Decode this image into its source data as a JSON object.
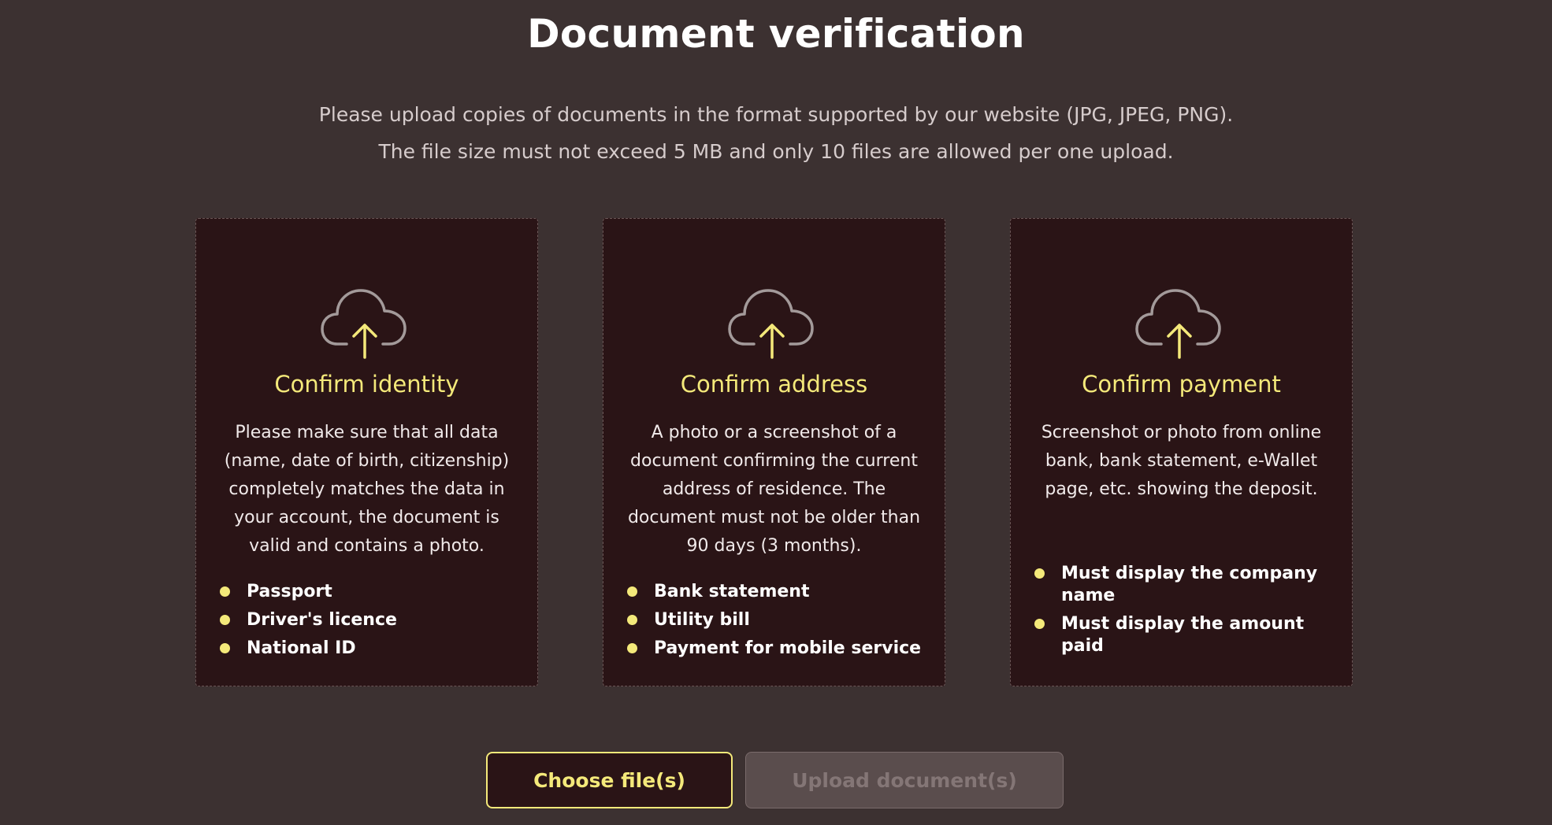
{
  "page": {
    "title": "Document verification",
    "intro_line1": "Please upload copies of documents in the format supported by our website (JPG, JPEG, PNG).",
    "intro_line2": "The file size must not exceed 5 MB and only 10 files are allowed per one upload."
  },
  "cards": [
    {
      "icon": "cloud-upload-icon",
      "title": "Confirm identity",
      "description": "Please make sure that all data (name, date of birth, citizenship) completely matches the data in your account, the document is valid and contains a photo.",
      "items": [
        "Passport",
        "Driver's licence",
        "National ID"
      ]
    },
    {
      "icon": "cloud-upload-icon",
      "title": "Confirm address",
      "description": "A photo or a screenshot of a document confirming the current address of residence. The document must not be older than 90 days (3 months).",
      "items": [
        "Bank statement",
        "Utility bill",
        "Payment for mobile service"
      ]
    },
    {
      "icon": "cloud-upload-icon",
      "title": "Confirm payment",
      "description": "Screenshot or photo from online bank, bank statement, e-Wallet page, etc. showing the deposit.",
      "items": [
        "Must display the company name",
        "Must display the amount paid"
      ]
    }
  ],
  "actions": {
    "choose_label": "Choose file(s)",
    "upload_label": "Upload document(s)"
  },
  "colors": {
    "background": "#3c3131",
    "card_background": "#2a1416",
    "accent": "#f4e97a",
    "disabled_button": "#5a4d4d"
  }
}
